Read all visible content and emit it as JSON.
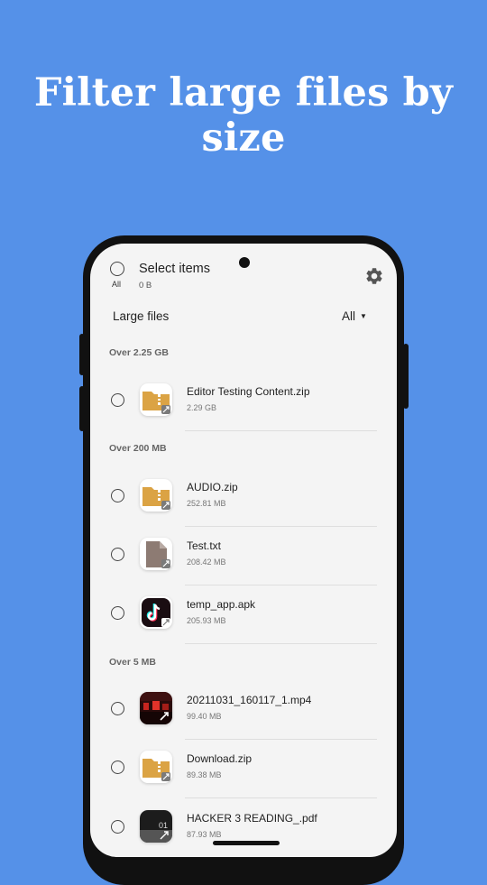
{
  "headline": "Filter large files by size",
  "header": {
    "all_label": "All",
    "select_title": "Select items",
    "selected_size": "0 B"
  },
  "toolbar": {
    "list_title": "Large files",
    "filter_value": "All",
    "settings_icon": "gear-icon"
  },
  "sections": {
    "s1": "Over 2.25 GB",
    "s2": "Over 200 MB",
    "s3": "Over 5 MB"
  },
  "files": [
    {
      "name": "Editor Testing Content.zip",
      "size": "2.29 GB",
      "icon": "zip-folder-icon"
    },
    {
      "name": "AUDIO.zip",
      "size": "252.81 MB",
      "icon": "zip-folder-icon"
    },
    {
      "name": "Test.txt",
      "size": "208.42 MB",
      "icon": "document-icon"
    },
    {
      "name": "temp_app.apk",
      "size": "205.93 MB",
      "icon": "tiktok-app-icon"
    },
    {
      "name": "20211031_160117_1.mp4",
      "size": "99.40 MB",
      "icon": "video-thumbnail"
    },
    {
      "name": "Download.zip",
      "size": "89.38 MB",
      "icon": "zip-folder-icon"
    },
    {
      "name": "HACKER 3 READING_.pdf",
      "size": "87.93 MB",
      "icon": "pdf-thumbnail"
    }
  ],
  "colors": {
    "background": "#5591e8",
    "folder": "#dba344",
    "document": "#8d7b73",
    "screen": "#f4f4f4"
  }
}
